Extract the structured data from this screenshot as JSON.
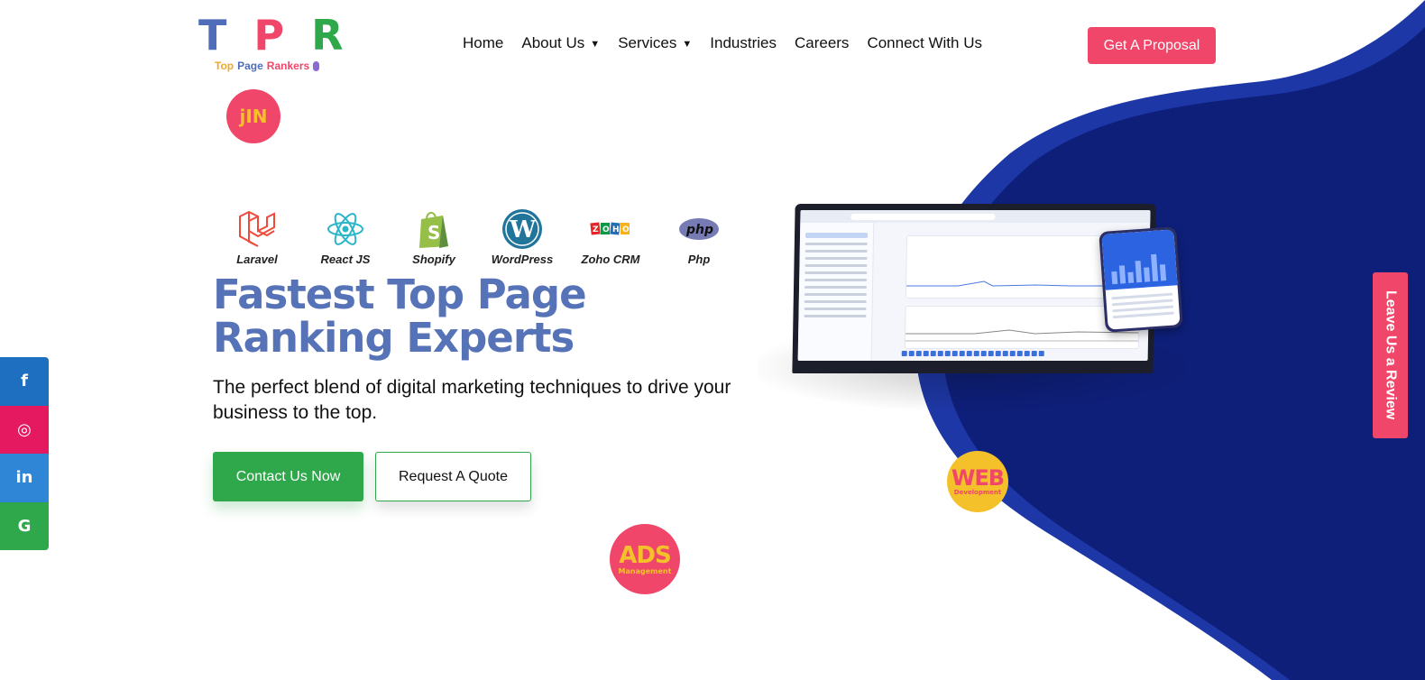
{
  "brand": {
    "letters": [
      "T",
      "P",
      "R"
    ],
    "letter_colors": [
      "#4f6db8",
      "#f0466a",
      "#2ea84a"
    ],
    "tagline_words": [
      "Top",
      "Page",
      "Rankers"
    ],
    "tagline_colors": [
      "#f0a830",
      "#4f6db8",
      "#f0466a"
    ]
  },
  "nav": {
    "items": [
      {
        "label": "Home"
      },
      {
        "label": "About Us",
        "dropdown": true
      },
      {
        "label": "Services",
        "dropdown": true
      },
      {
        "label": "Industries"
      },
      {
        "label": "Careers"
      },
      {
        "label": "Connect With Us"
      }
    ],
    "cta": "Get A Proposal"
  },
  "tech": [
    {
      "label": "Laravel",
      "icon": "laravel-icon"
    },
    {
      "label": "React JS",
      "icon": "react-icon"
    },
    {
      "label": "Shopify",
      "icon": "shopify-icon"
    },
    {
      "label": "WordPress",
      "icon": "wordpress-icon"
    },
    {
      "label": "Zoho CRM",
      "icon": "zoho-icon"
    },
    {
      "label": "Php",
      "icon": "php-icon"
    }
  ],
  "hero": {
    "title_line1": "Fastest Top Page",
    "title_line2": "Ranking Experts",
    "subtitle": "The perfect blend of digital marketing techniques to drive your business to the top.",
    "primary_button": "Contact Us Now",
    "secondary_button": "Request A Quote"
  },
  "bubbles": {
    "top": "jΙN",
    "ads_big": "ADS",
    "ads_small": "Management",
    "web_big": "WEB",
    "web_small": "Development"
  },
  "social": [
    {
      "icon": "facebook-icon",
      "glyph": "f",
      "color": "#1f6fc1"
    },
    {
      "icon": "instagram-icon",
      "glyph": "◎",
      "color": "#e5195f"
    },
    {
      "icon": "linkedin-icon",
      "glyph": "in",
      "color": "#2f86d6"
    },
    {
      "icon": "google-icon",
      "glyph": "G",
      "color": "#2ea84a"
    }
  ],
  "review_tab": "Leave Us a Review",
  "colors": {
    "accent": "#f0466a",
    "primary_green": "#2ea84a",
    "heading_blue": "#5773b8",
    "navy": "#0e1f7a",
    "yellow": "#f5c12b"
  }
}
